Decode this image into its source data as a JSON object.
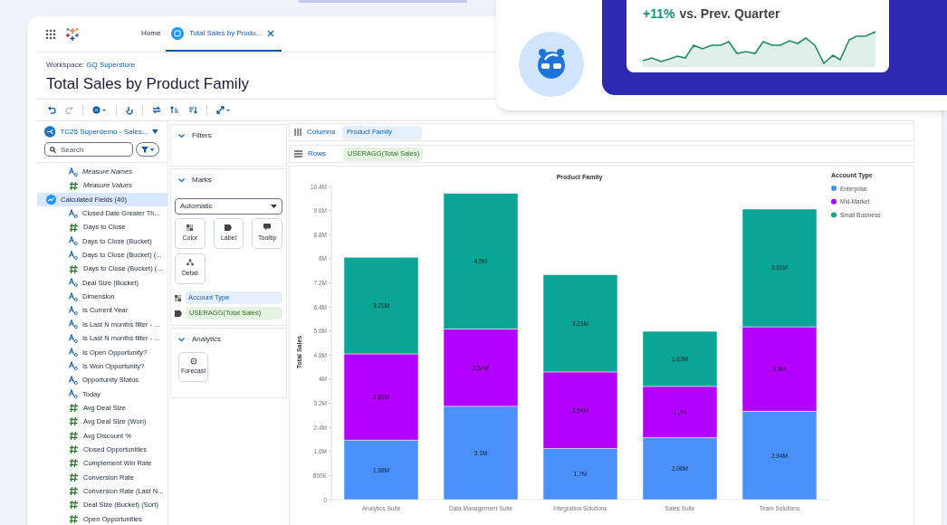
{
  "app": {
    "tabs": [
      {
        "label": "Home",
        "selected": false,
        "kind": "home"
      },
      {
        "label": "Total Sales by Produ...",
        "selected": true,
        "kind": "workbook"
      }
    ]
  },
  "workspace": {
    "label": "Workspace:",
    "name": "GQ Superstore"
  },
  "title": "Total Sales by Product Family",
  "data_pane": {
    "source": "TC25 Superdemo - Sales...",
    "search": {
      "placeholder": "Search"
    },
    "fields": [
      {
        "label": "Measure Names",
        "kind": "generated_dimension",
        "selected": false
      },
      {
        "label": "Measure Values",
        "kind": "generated_measure",
        "selected": false
      },
      {
        "label": "Calculated Fields (40)",
        "kind": "folder",
        "selected": true,
        "children": [
          {
            "label": "Closed Date Greater Th...",
            "kind": "dimension",
            "selected": false
          },
          {
            "label": "Days to Close",
            "kind": "measure",
            "selected": false
          },
          {
            "label": "Days to Close (Bucket)",
            "kind": "dimension",
            "selected": false
          },
          {
            "label": "Days to Close (Bucket) (...",
            "kind": "dimension",
            "selected": false
          },
          {
            "label": "Days to Close (Bucket) (...",
            "kind": "measure",
            "selected": false
          },
          {
            "label": "Deal Size (Bucket)",
            "kind": "dimension",
            "selected": false
          },
          {
            "label": "Dimension",
            "kind": "dimension",
            "selected": false
          },
          {
            "label": "Is Current Year",
            "kind": "dimension",
            "selected": false
          },
          {
            "label": "Is Last N months filter - ...",
            "kind": "dimension",
            "selected": false
          },
          {
            "label": "Is Last N months filter - ...",
            "kind": "dimension",
            "selected": false
          },
          {
            "label": "Is Open Opportunity?",
            "kind": "dimension",
            "selected": false
          },
          {
            "label": "Is Won Opportunity?",
            "kind": "dimension",
            "selected": false
          },
          {
            "label": "Opportunity Status",
            "kind": "dimension",
            "selected": false
          },
          {
            "label": "Today",
            "kind": "dimension",
            "selected": false
          },
          {
            "label": "Avg Deal Size",
            "kind": "measure",
            "selected": false
          },
          {
            "label": "Avg Deal Size (Won)",
            "kind": "measure",
            "selected": false
          },
          {
            "label": "Avg Discount %",
            "kind": "measure",
            "selected": false
          },
          {
            "label": "Closed Opportunities",
            "kind": "measure",
            "selected": false
          },
          {
            "label": "Complement Win Rate",
            "kind": "measure",
            "selected": false
          },
          {
            "label": "Conversion Rate",
            "kind": "measure",
            "selected": false
          },
          {
            "label": "Conversion Rate (Last N...",
            "kind": "measure",
            "selected": false
          },
          {
            "label": "Deal Size (Bucket) (Sort)",
            "kind": "measure",
            "selected": false
          },
          {
            "label": "Open Opportunities",
            "kind": "measure",
            "selected": false
          }
        ]
      }
    ]
  },
  "cards": {
    "filters": {
      "title": "Filters"
    },
    "marks": {
      "title": "Marks",
      "mark_type": "Automatic",
      "buttons": [
        {
          "label": "Color",
          "kind": "color"
        },
        {
          "label": "Label",
          "kind": "label"
        },
        {
          "label": "Tooltip",
          "kind": "tooltip"
        },
        {
          "label": "Detail",
          "kind": "detail"
        }
      ],
      "pills": [
        {
          "label": "Account Type",
          "kind": "color"
        },
        {
          "label": "USERAGG(Total Sales)",
          "kind": "label"
        }
      ]
    },
    "analytics": {
      "title": "Analytics",
      "buttons": [
        {
          "label": "Forecast"
        }
      ]
    }
  },
  "shelves": [
    {
      "label": "Columns",
      "kind": "columns",
      "pill": {
        "label": "Product Family",
        "kind": "dimension"
      }
    },
    {
      "label": "Rows",
      "kind": "rows",
      "pill": {
        "label": "USERAGG(Total Sales)",
        "kind": "measure"
      }
    }
  ],
  "chart": {
    "chart_data": {
      "type": "bar",
      "title": "Product Family",
      "ylabel": "Total Sales",
      "legend": {
        "title": "Account Type"
      },
      "stacked": true,
      "orientation": "vertical",
      "categories": [
        "Analytics Suite",
        "Data Management Suite",
        "Integration Solutions",
        "Sales Suite",
        "Team Solutions"
      ],
      "series": [
        {
          "name": "Enterprise",
          "color": "#4a90f8",
          "values": [
            1980000,
            3100000,
            1700000,
            2060000,
            2940000
          ],
          "value_labels": [
            "1.98M",
            "3.1M",
            "1.7M",
            "2.06M",
            "2.94M"
          ]
        },
        {
          "name": "Mid-Market",
          "color": "#b300ff",
          "values": [
            2860000,
            2570000,
            2540000,
            1700000,
            2800000
          ],
          "value_labels": [
            "2.86M",
            "2.57M",
            "2.54M",
            "1.7M",
            "2.8M"
          ]
        },
        {
          "name": "Small Business",
          "color": "#0aa597",
          "values": [
            3210000,
            4500000,
            3230000,
            1830000,
            3910000
          ],
          "value_labels": [
            "3.21M",
            "4.5M",
            "3.23M",
            "1.83M",
            "3.91M"
          ]
        }
      ],
      "ylim": [
        0,
        10400000
      ],
      "yticks": [
        {
          "value": 0,
          "label": "0"
        },
        {
          "value": 800000,
          "label": "800K"
        },
        {
          "value": 1600000,
          "label": "1.6M"
        },
        {
          "value": 2400000,
          "label": "2.4M"
        },
        {
          "value": 3200000,
          "label": "3.2M"
        },
        {
          "value": 4000000,
          "label": "4M"
        },
        {
          "value": 4800000,
          "label": "4.8M"
        },
        {
          "value": 5600000,
          "label": "5.6M"
        },
        {
          "value": 6400000,
          "label": "6.4M"
        },
        {
          "value": 7200000,
          "label": "7.2M"
        },
        {
          "value": 8000000,
          "label": "8M"
        },
        {
          "value": 8800000,
          "label": "8.8M"
        },
        {
          "value": 9600000,
          "label": "9.6M"
        },
        {
          "value": 10400000,
          "label": "10.4M"
        }
      ]
    }
  },
  "insight": {
    "change": "+11%",
    "comparison": "vs. Prev. Quarter"
  }
}
